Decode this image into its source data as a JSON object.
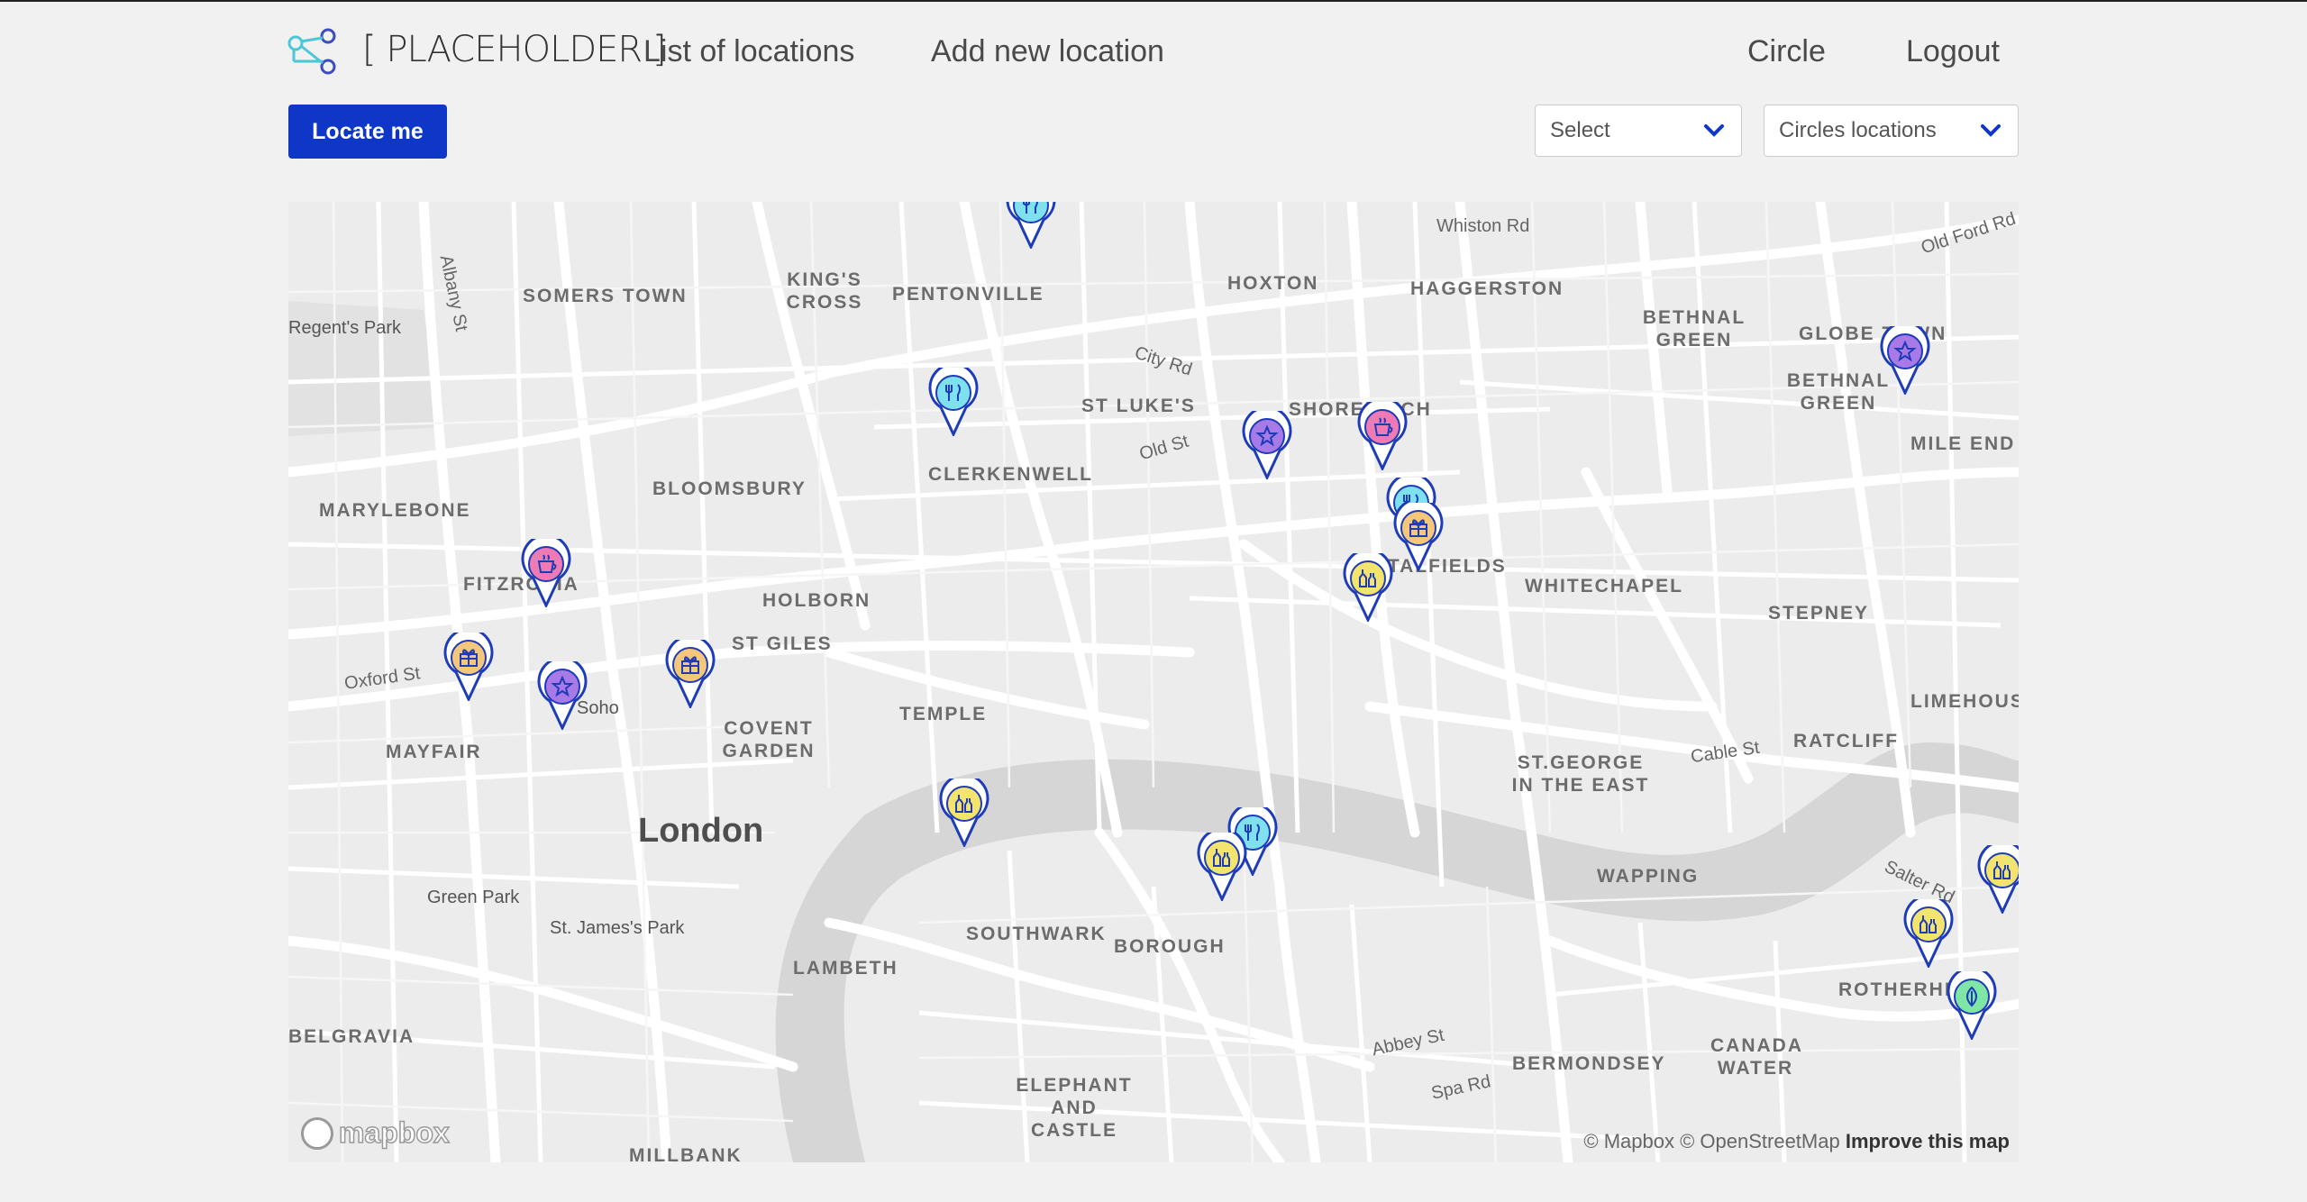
{
  "nav": {
    "brand": "[ PLACEHOLDER ]",
    "links": [
      "List of locations",
      "Add new location"
    ],
    "right_links": [
      "Circle",
      "Logout"
    ]
  },
  "toolbar": {
    "locate_label": "Locate me",
    "select_label": "Select",
    "circles_label": "Circles locations"
  },
  "map": {
    "city": "London",
    "places": [
      "SOMERS TOWN",
      "KING'S CROSS",
      "PENTONVILLE",
      "HOXTON",
      "HAGGERSTON",
      "BETHNAL GREEN",
      "GLOBE TOWN",
      "BETHNAL GREEN",
      "MILE END",
      "ST LUKE'S",
      "SHOREDITCH",
      "CLERKENWELL",
      "BLOOMSBURY",
      "MARYLEBONE",
      "FITZROVIA",
      "HOLBORN",
      "ST GILES",
      "SPITALFIELDS",
      "WHITECHAPEL",
      "STEPNEY",
      "MAYFAIR",
      "COVENT GARDEN",
      "TEMPLE",
      "LIMEHOUSE",
      "RATCLIFF",
      "ST.GEORGE IN THE EAST",
      "WAPPING",
      "SOUTHWARK",
      "BOROUGH",
      "LAMBETH",
      "ROTHERHITHE",
      "CANADA WATER",
      "BERMONDSEY",
      "BELGRAVIA",
      "ELEPHANT AND CASTLE",
      "MILLBANK"
    ],
    "small_places": [
      "Soho",
      "Green Park",
      "St. James's Park",
      "Regent's Park"
    ],
    "streets": [
      "Whiston Rd",
      "Old Ford Rd",
      "Albany St",
      "City Rd",
      "Old St",
      "Oxford St",
      "Cable St",
      "Salter Rd",
      "Abbey St",
      "Spa Rd"
    ],
    "attribution": "© Mapbox © OpenStreetMap",
    "improve": "Improve this map",
    "mapbox_logo": "mapbox"
  },
  "markers": [
    {
      "category": "restaurant",
      "icon": "fork-knife-icon",
      "color": "#7fe0ee"
    },
    {
      "category": "restaurant",
      "icon": "fork-knife-icon",
      "color": "#7fe0ee"
    },
    {
      "category": "attraction",
      "icon": "star-icon",
      "color": "#a77ae8"
    },
    {
      "category": "cafe",
      "icon": "coffee-cup-icon",
      "color": "#f07ab6"
    },
    {
      "category": "restaurant",
      "icon": "fork-knife-icon",
      "color": "#7fe0ee"
    },
    {
      "category": "shop",
      "icon": "gift-icon",
      "color": "#f5c77a"
    },
    {
      "category": "bar",
      "icon": "bottles-icon",
      "color": "#f3e46e"
    },
    {
      "category": "attraction",
      "icon": "star-icon",
      "color": "#a77ae8"
    },
    {
      "category": "cafe",
      "icon": "coffee-cup-icon",
      "color": "#f07ab6"
    },
    {
      "category": "shop",
      "icon": "gift-icon",
      "color": "#f5c77a"
    },
    {
      "category": "attraction",
      "icon": "star-icon",
      "color": "#a77ae8"
    },
    {
      "category": "shop",
      "icon": "gift-icon",
      "color": "#f5c77a"
    },
    {
      "category": "bar",
      "icon": "bottles-icon",
      "color": "#f3e46e"
    },
    {
      "category": "restaurant",
      "icon": "fork-knife-icon",
      "color": "#7fe0ee"
    },
    {
      "category": "bar",
      "icon": "bottles-icon",
      "color": "#f3e46e"
    },
    {
      "category": "bar",
      "icon": "bottles-icon",
      "color": "#f3e46e"
    },
    {
      "category": "bar",
      "icon": "bottles-icon",
      "color": "#f3e46e"
    },
    {
      "category": "nature",
      "icon": "leaf-icon",
      "color": "#7fe6a6"
    }
  ],
  "colors": {
    "accent": "#0f37c7",
    "map_land": "#ececec",
    "map_road": "#ffffff",
    "map_water": "#d6d6d6",
    "marker_border": "#1e3bb8"
  }
}
